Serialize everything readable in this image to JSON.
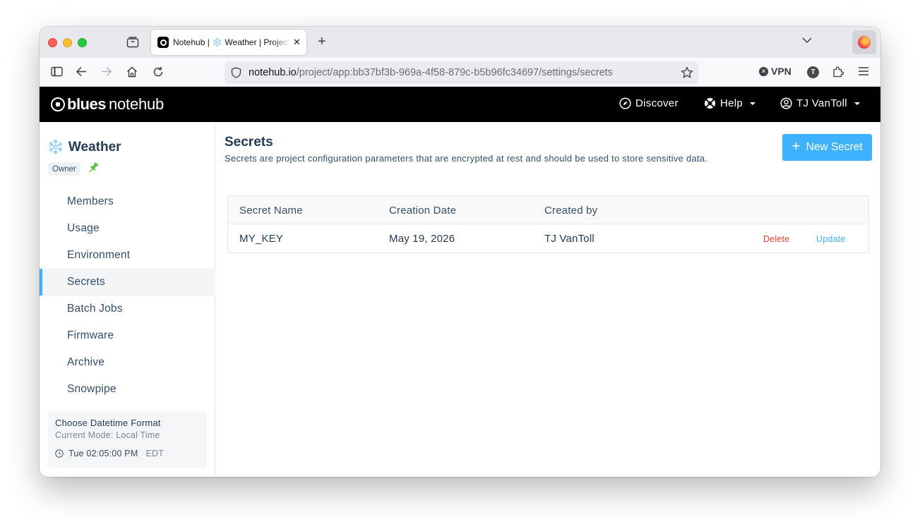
{
  "browser": {
    "tab_title": "Notehub | ❄️ Weather | Project Settings",
    "url_host": "notehub.io",
    "url_path": "/project/app:bb37bf3b-969a-4f58-879c-b5b96fc34697/settings/secrets",
    "vpn_label": "VPN",
    "account_initial": "T"
  },
  "header": {
    "brand_bold": "blues",
    "brand_light": "notehub",
    "discover_label": "Discover",
    "help_label": "Help",
    "user_label": "TJ VanToll"
  },
  "sidebar": {
    "project_icon": "❄️",
    "project_name": "Weather",
    "role_badge": "Owner",
    "items": [
      {
        "label": "Members"
      },
      {
        "label": "Usage"
      },
      {
        "label": "Environment"
      },
      {
        "label": "Secrets",
        "active": true
      },
      {
        "label": "Batch Jobs"
      },
      {
        "label": "Firmware"
      },
      {
        "label": "Archive"
      },
      {
        "label": "Snowpipe"
      }
    ],
    "datetime": {
      "title": "Choose Datetime Format",
      "mode": "Current Mode: Local Time",
      "time": "Tue 02:05:00 PM",
      "tz": "EDT"
    }
  },
  "main": {
    "title": "Secrets",
    "description": "Secrets are project configuration parameters that are encrypted at rest and should be used to store sensitive data.",
    "new_button": "New Secret",
    "table": {
      "headers": [
        "Secret Name",
        "Creation Date",
        "Created by"
      ],
      "rows": [
        {
          "name": "MY_KEY",
          "date": "May 19, 2026",
          "created_by": "TJ VanToll",
          "delete": "Delete",
          "update": "Update"
        }
      ]
    }
  },
  "colors": {
    "accent": "#3eb1ff",
    "danger": "#e0442e",
    "header_bg": "#000000"
  }
}
